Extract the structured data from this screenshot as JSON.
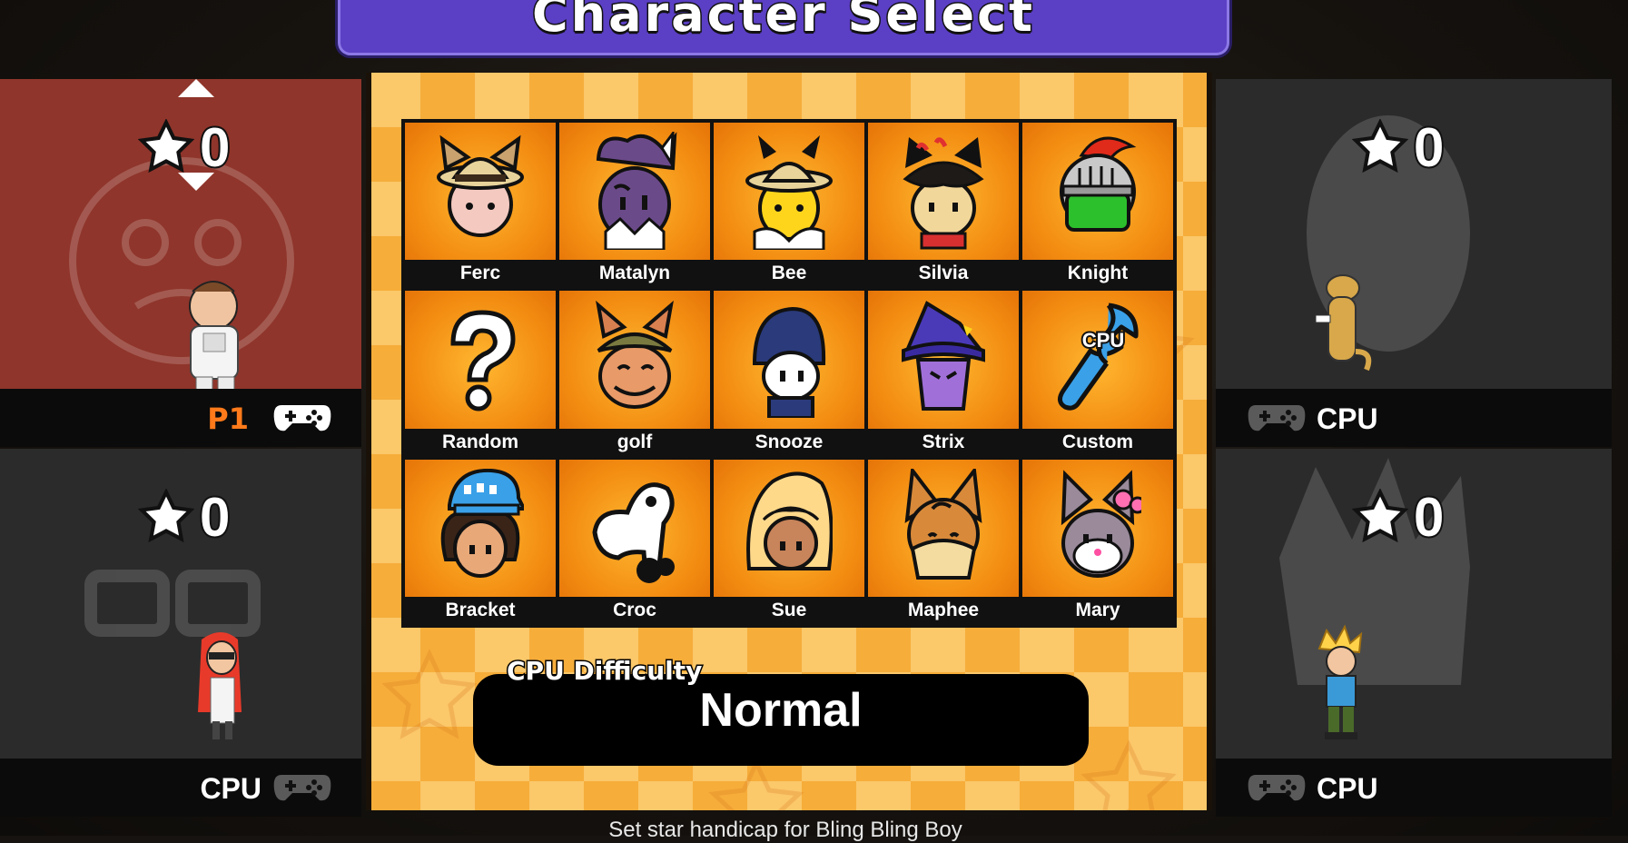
{
  "title": "Character Select",
  "players": [
    {
      "id": "p1",
      "stars": "0",
      "tag": "P1",
      "tag_color": "#ff7a1a",
      "panel_color": "#8f352b",
      "controller_color": "#ffffff"
    },
    {
      "id": "p2",
      "stars": "0",
      "tag": "CPU",
      "tag_color": "#ffffff",
      "panel_color": "#2b2b2b",
      "controller_color": "#5a5a5a"
    },
    {
      "id": "p3",
      "stars": "0",
      "tag": "CPU",
      "tag_color": "#ffffff",
      "panel_color": "#2b2b2b",
      "controller_color": "#5a5a5a"
    },
    {
      "id": "p4",
      "stars": "0",
      "tag": "CPU",
      "tag_color": "#ffffff",
      "panel_color": "#2b2b2b",
      "controller_color": "#5a5a5a"
    }
  ],
  "characters": [
    {
      "name": "Ferc",
      "icon": "ferc-portrait"
    },
    {
      "name": "Matalyn",
      "icon": "matalyn-portrait"
    },
    {
      "name": "Bee",
      "icon": "bee-portrait"
    },
    {
      "name": "Silvia",
      "icon": "silvia-portrait"
    },
    {
      "name": "Knight",
      "icon": "knight-portrait"
    },
    {
      "name": "Random",
      "icon": "question-mark-icon"
    },
    {
      "name": "golf",
      "icon": "golf-portrait"
    },
    {
      "name": "Snooze",
      "icon": "snooze-portrait"
    },
    {
      "name": "Strix",
      "icon": "strix-portrait"
    },
    {
      "name": "Custom",
      "icon": "wrench-icon",
      "badge": "CPU"
    },
    {
      "name": "Bracket",
      "icon": "bracket-portrait"
    },
    {
      "name": "Croc",
      "icon": "croc-portrait"
    },
    {
      "name": "Sue",
      "icon": "sue-portrait"
    },
    {
      "name": "Maphee",
      "icon": "maphee-portrait"
    },
    {
      "name": "Mary",
      "icon": "mary-portrait"
    }
  ],
  "difficulty": {
    "label": "CPU Difficulty",
    "value": "Normal"
  },
  "hint": "Set star handicap for Bling Bling Boy",
  "colors": {
    "title_bg": "#5b3fc4",
    "board": "#f7b94e",
    "cell": "#f28a10"
  }
}
